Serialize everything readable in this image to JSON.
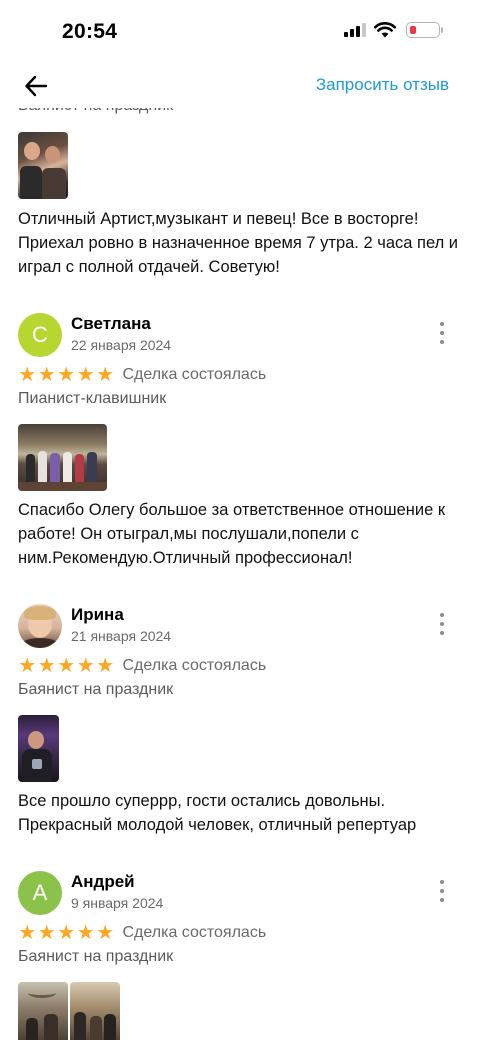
{
  "status_bar": {
    "time": "20:54",
    "battery_color": "#e8394a"
  },
  "nav": {
    "back_icon": "arrow-left-icon",
    "request_review": "Запросить отзыв",
    "accent_color": "#1e9bd6"
  },
  "top_review": {
    "category": "Баянист на праздник",
    "photo_count": 1,
    "text": "Отличный Артист,музыкант и певец! Все в восторге! Приехал  ровно в назначенное время 7 утра. 2 часа пел и играл с полной отдачей. Советую!"
  },
  "reviews": [
    {
      "avatar_letter": "С",
      "avatar_color": "#b6d630",
      "name": "Светлана",
      "date": "22 января 2024",
      "rating": 5,
      "deal_status": "Сделка состоялась",
      "category": "Пианист-клавишник",
      "text": "Спасибо Олегу большое за ответственное отношение к работе! Он отыграл,мы послушали,попели с ним.Рекомендую.Отличный профессионал!"
    },
    {
      "avatar_letter": "",
      "name": "Ирина",
      "date": "21 января 2024",
      "rating": 5,
      "deal_status": "Сделка состоялась",
      "category": "Баянист на праздник",
      "text": "Все прошло суперрр, гости остались довольны. Прекрасный молодой человек, отличный репертуар"
    },
    {
      "avatar_letter": "А",
      "avatar_color": "#8bc34a",
      "name": "Андрей",
      "date": "9 января 2024",
      "rating": 5,
      "deal_status": "Сделка состоялась",
      "category": "Баянист на праздник",
      "text": ""
    }
  ],
  "star_glyph": "★",
  "star_color": "#ffa722"
}
